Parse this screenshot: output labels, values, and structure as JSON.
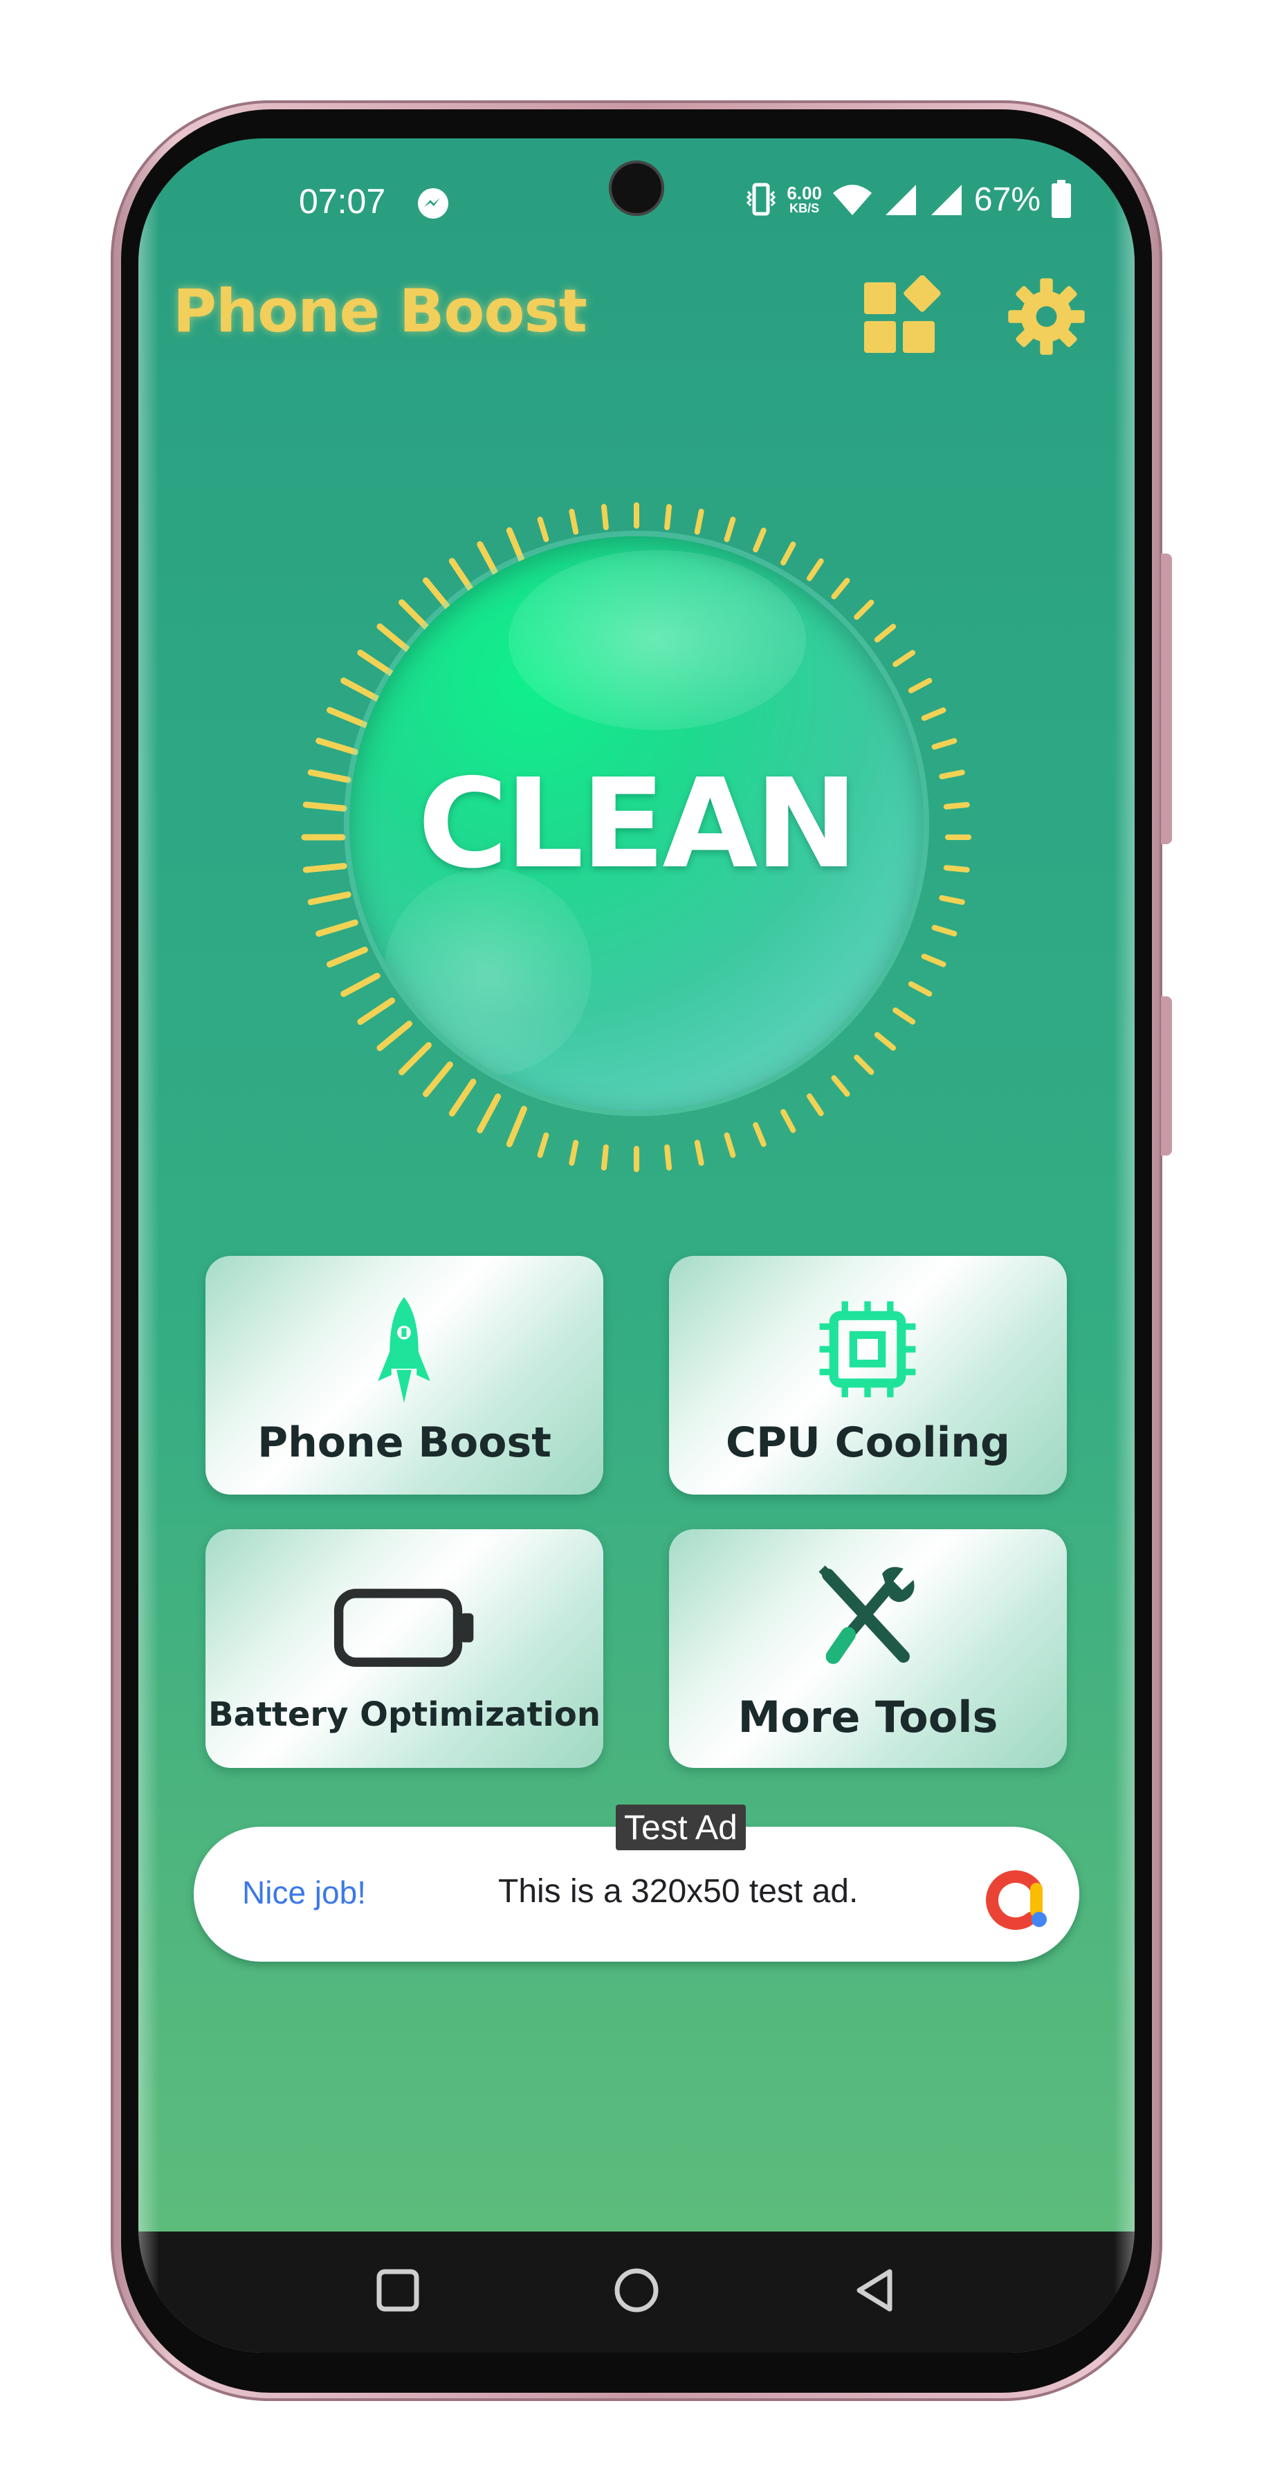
{
  "status_bar": {
    "time": "07:07",
    "net_speed_value": "6.00",
    "net_speed_unit": "KB/S",
    "battery_percent": "67%"
  },
  "app_bar": {
    "title": "Phone Boost",
    "title_color": "#f2cf5a",
    "apps_icon": "apps-grid-icon",
    "settings_icon": "gear-icon"
  },
  "clean_button": {
    "label": "CLEAN"
  },
  "features": [
    {
      "label": "Phone Boost",
      "icon": "rocket-icon"
    },
    {
      "label": "CPU Cooling",
      "icon": "cpu-chip-icon"
    },
    {
      "label": "Battery Optimization",
      "icon": "battery-icon"
    },
    {
      "label": "More Tools",
      "icon": "tools-icon"
    }
  ],
  "ad": {
    "badge": "Test Ad",
    "headline": "Nice job!",
    "body": "This is a 320x50 test ad."
  },
  "nav_bar": {
    "buttons": [
      "recent-apps-icon",
      "home-icon",
      "back-icon"
    ]
  },
  "colors": {
    "background_top": "#2a9e80",
    "background_bottom": "#62be7c",
    "accent_green": "#1fe39a",
    "dial_ticks": "#f2d255"
  }
}
